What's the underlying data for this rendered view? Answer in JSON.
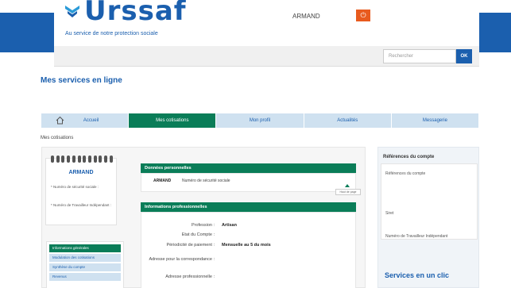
{
  "header": {
    "logo_text": "Urssaf",
    "tagline": "Au service de notre protection sociale",
    "username": "ARMAND",
    "search_placeholder": "Rechercher",
    "search_button": "OK"
  },
  "main_title": "Mes services en ligne",
  "nav": {
    "items": [
      {
        "label": "Accueil",
        "active": false
      },
      {
        "label": "Mes cotisations",
        "active": true
      },
      {
        "label": "Mon profil",
        "active": false
      },
      {
        "label": "Actualités",
        "active": false
      },
      {
        "label": "Messagerie",
        "active": false
      }
    ]
  },
  "breadcrumb": "Mes cotisations",
  "card": {
    "name": "ARMAND",
    "line1": "* Numéro de sécurité sociale :",
    "line2": "* Numéro de Travailleur Indépendant :"
  },
  "side_menu": {
    "items": [
      {
        "label": "Informations générales",
        "active": true
      },
      {
        "label": "Modulation des cotisations",
        "active": false
      },
      {
        "label": "Synthèse du compte",
        "active": false
      },
      {
        "label": "Revenus",
        "active": false
      }
    ]
  },
  "personal": {
    "title": "Données personnelles",
    "name": "ARMAND",
    "ssn_label": "Numéro de sécurité sociale"
  },
  "top_button": "Haut de page",
  "professional": {
    "title": "Informations professionnelles",
    "profession_label": "Profession :",
    "profession_value": "Artisan",
    "state_label": "Etat du Compte :",
    "periodicity_label": "Périodicité de paiement :",
    "periodicity_value": "Mensuelle au 5 du mois",
    "correspondence_label": "Adresse pour la correspondance :",
    "pro_address_label": "Adresse professionnelle :"
  },
  "right": {
    "title": "Références du compte",
    "ref_label": "Références du compte",
    "siret_label": "Siret",
    "ti_label": "Numéro de Travailleur Indépendant",
    "services_title": "Services en un clic"
  },
  "colors": {
    "brand_blue": "#1b5fae",
    "active_green": "#0a7d58",
    "nav_light": "#cfe1f0",
    "logout_orange": "#e85b1e"
  }
}
